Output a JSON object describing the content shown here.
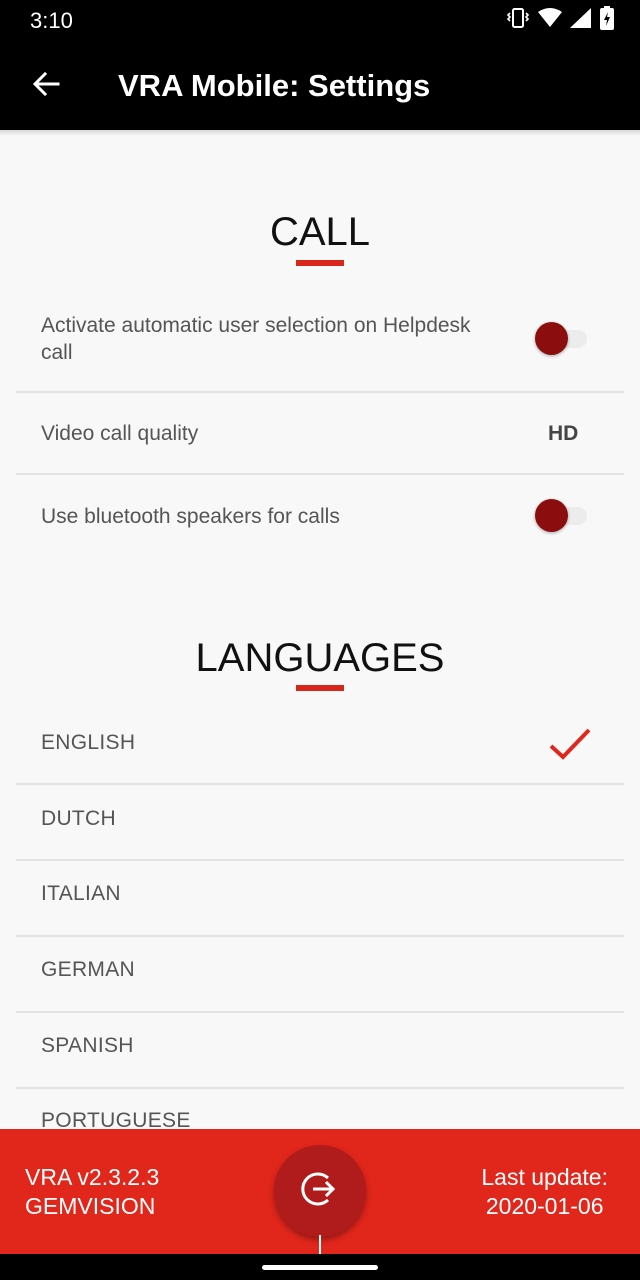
{
  "status_bar": {
    "time": "3:10",
    "icons": [
      "vibrate-icon",
      "wifi-icon",
      "signal-icon",
      "battery-charging-icon"
    ]
  },
  "app_bar": {
    "title": "VRA Mobile: Settings",
    "back_icon": "arrow-left-icon"
  },
  "call_section": {
    "title": "CALL",
    "items": [
      {
        "label": "Activate automatic user selection on Helpdesk call",
        "type": "toggle",
        "checked": false
      },
      {
        "label": "Video call quality",
        "type": "value",
        "value": "HD"
      },
      {
        "label": "Use bluetooth speakers for calls",
        "type": "toggle",
        "checked": false
      }
    ]
  },
  "languages_section": {
    "title": "LANGUAGES",
    "items": [
      {
        "label": "ENGLISH",
        "selected": true
      },
      {
        "label": "DUTCH",
        "selected": false
      },
      {
        "label": "ITALIAN",
        "selected": false
      },
      {
        "label": "GERMAN",
        "selected": false
      },
      {
        "label": "SPANISH",
        "selected": false
      },
      {
        "label": "PORTUGUESE",
        "selected": false
      }
    ]
  },
  "footer": {
    "version_line1": "VRA v2.3.2.3",
    "version_line2": "GEMVISION",
    "update_line1": "Last update:",
    "update_line2": "2020-01-06",
    "logout_icon": "logout-icon"
  },
  "colors": {
    "accent": "#e1261c",
    "toggle_thumb": "#8b0d0d",
    "logout_button": "#b01b1b",
    "appbar": "#000000",
    "background": "#f8f8f8"
  }
}
